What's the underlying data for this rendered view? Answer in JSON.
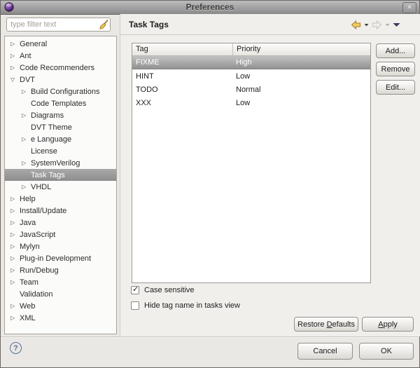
{
  "window": {
    "title": "Preferences"
  },
  "icons": {
    "close": "✕",
    "help": "?",
    "check": "✓",
    "expander_collapsed": "▷",
    "expander_expanded": "▽"
  },
  "sidebar": {
    "filter_placeholder": "type filter text",
    "tree": [
      {
        "label": "General",
        "arrow": "collapsed",
        "level": 0,
        "selected": false
      },
      {
        "label": "Ant",
        "arrow": "collapsed",
        "level": 0,
        "selected": false
      },
      {
        "label": "Code Recommenders",
        "arrow": "collapsed",
        "level": 0,
        "selected": false
      },
      {
        "label": "DVT",
        "arrow": "expanded",
        "level": 0,
        "selected": false
      },
      {
        "label": "Build Configurations",
        "arrow": "collapsed",
        "level": 1,
        "selected": false
      },
      {
        "label": "Code Templates",
        "arrow": "none",
        "level": 1,
        "selected": false
      },
      {
        "label": "Diagrams",
        "arrow": "collapsed",
        "level": 1,
        "selected": false
      },
      {
        "label": "DVT Theme",
        "arrow": "none",
        "level": 1,
        "selected": false
      },
      {
        "label": "e Language",
        "arrow": "collapsed",
        "level": 1,
        "selected": false
      },
      {
        "label": "License",
        "arrow": "none",
        "level": 1,
        "selected": false
      },
      {
        "label": "SystemVerilog",
        "arrow": "collapsed",
        "level": 1,
        "selected": false
      },
      {
        "label": "Task Tags",
        "arrow": "none",
        "level": 1,
        "selected": true
      },
      {
        "label": "VHDL",
        "arrow": "collapsed",
        "level": 1,
        "selected": false
      },
      {
        "label": "Help",
        "arrow": "collapsed",
        "level": 0,
        "selected": false
      },
      {
        "label": "Install/Update",
        "arrow": "collapsed",
        "level": 0,
        "selected": false
      },
      {
        "label": "Java",
        "arrow": "collapsed",
        "level": 0,
        "selected": false
      },
      {
        "label": "JavaScript",
        "arrow": "collapsed",
        "level": 0,
        "selected": false
      },
      {
        "label": "Mylyn",
        "arrow": "collapsed",
        "level": 0,
        "selected": false
      },
      {
        "label": "Plug-in Development",
        "arrow": "collapsed",
        "level": 0,
        "selected": false
      },
      {
        "label": "Run/Debug",
        "arrow": "collapsed",
        "level": 0,
        "selected": false
      },
      {
        "label": "Team",
        "arrow": "collapsed",
        "level": 0,
        "selected": false
      },
      {
        "label": "Validation",
        "arrow": "none",
        "level": 0,
        "selected": false
      },
      {
        "label": "Web",
        "arrow": "collapsed",
        "level": 0,
        "selected": false
      },
      {
        "label": "XML",
        "arrow": "collapsed",
        "level": 0,
        "selected": false
      }
    ]
  },
  "main": {
    "title": "Task Tags",
    "table": {
      "columns": [
        "Tag",
        "Priority"
      ],
      "rows": [
        {
          "tag": "FIXME",
          "priority": "High",
          "selected": true
        },
        {
          "tag": "HINT",
          "priority": "Low",
          "selected": false
        },
        {
          "tag": "TODO",
          "priority": "Normal",
          "selected": false
        },
        {
          "tag": "XXX",
          "priority": "Low",
          "selected": false
        }
      ]
    },
    "side_buttons": [
      "Add...",
      "Remove",
      "Edit..."
    ],
    "checkboxes": [
      {
        "label": "Case sensitive",
        "checked": true
      },
      {
        "label": "Hide tag name in tasks view",
        "checked": false
      }
    ],
    "restore_defaults": {
      "label": "Restore Defaults",
      "mnemonic": "D"
    },
    "apply": {
      "label": "Apply",
      "mnemonic": "A"
    }
  },
  "footer": {
    "cancel_label": "Cancel",
    "ok_label": "OK"
  },
  "colors": {
    "selection_gray": "#979797",
    "back_arrow_gold": "#f2cc62",
    "help_blue": "#54719b",
    "menu_triangle_navy": "#3a3863",
    "titlebar_gray": "#a3a3a3"
  }
}
